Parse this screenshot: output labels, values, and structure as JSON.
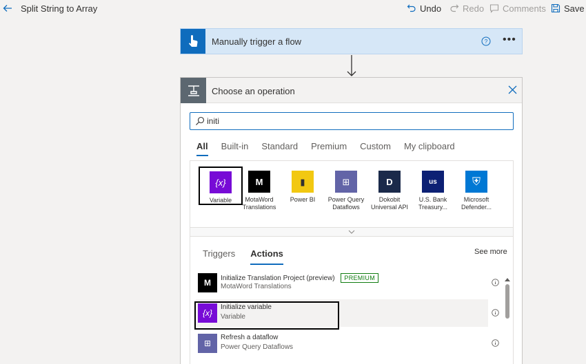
{
  "topbar": {
    "title": "Split String to Array",
    "undo_label": "Undo",
    "redo_label": "Redo",
    "comments_label": "Comments",
    "save_label": "Save"
  },
  "trigger": {
    "title": "Manually trigger a flow"
  },
  "operation": {
    "title": "Choose an operation",
    "search_value": "initi",
    "category_tabs": [
      "All",
      "Built-in",
      "Standard",
      "Premium",
      "Custom",
      "My clipboard"
    ],
    "active_category": "All",
    "connectors": [
      {
        "line1": "Variable",
        "line2": "",
        "color": "#770bd6",
        "glyph": "{x}"
      },
      {
        "line1": "MotaWord",
        "line2": "Translations",
        "color": "#000000",
        "glyph": "M"
      },
      {
        "line1": "Power BI",
        "line2": "",
        "color": "#f2c811",
        "glyph": "▮"
      },
      {
        "line1": "Power Query",
        "line2": "Dataflows",
        "color": "#6264a7",
        "glyph": "⊞"
      },
      {
        "line1": "Dokobit",
        "line2": "Universal API",
        "color": "#1b2a4a",
        "glyph": "D"
      },
      {
        "line1": "U.S. Bank",
        "line2": "Treasury...",
        "color": "#0c2074",
        "glyph": "us"
      },
      {
        "line1": "Microsoft",
        "line2": "Defender...",
        "color": "#0078d4",
        "glyph": "⛨"
      }
    ],
    "sub_tabs": [
      "Triggers",
      "Actions"
    ],
    "active_sub_tab": "Actions",
    "see_more": "See more",
    "actions": [
      {
        "title": "Initialize Translation Project (preview)",
        "subtitle": "MotaWord Translations",
        "badge": "PREMIUM",
        "color": "#000000",
        "glyph": "M"
      },
      {
        "title": "Initialize variable",
        "subtitle": "Variable",
        "badge": "",
        "color": "#770bd6",
        "glyph": "{x}"
      },
      {
        "title": "Refresh a dataflow",
        "subtitle": "Power Query Dataflows",
        "badge": "",
        "color": "#6264a7",
        "glyph": "⊞"
      }
    ]
  },
  "colors": {
    "accent": "#0f6cbd",
    "trigger_bg": "#d6e7f7",
    "premium": "#107c10"
  }
}
